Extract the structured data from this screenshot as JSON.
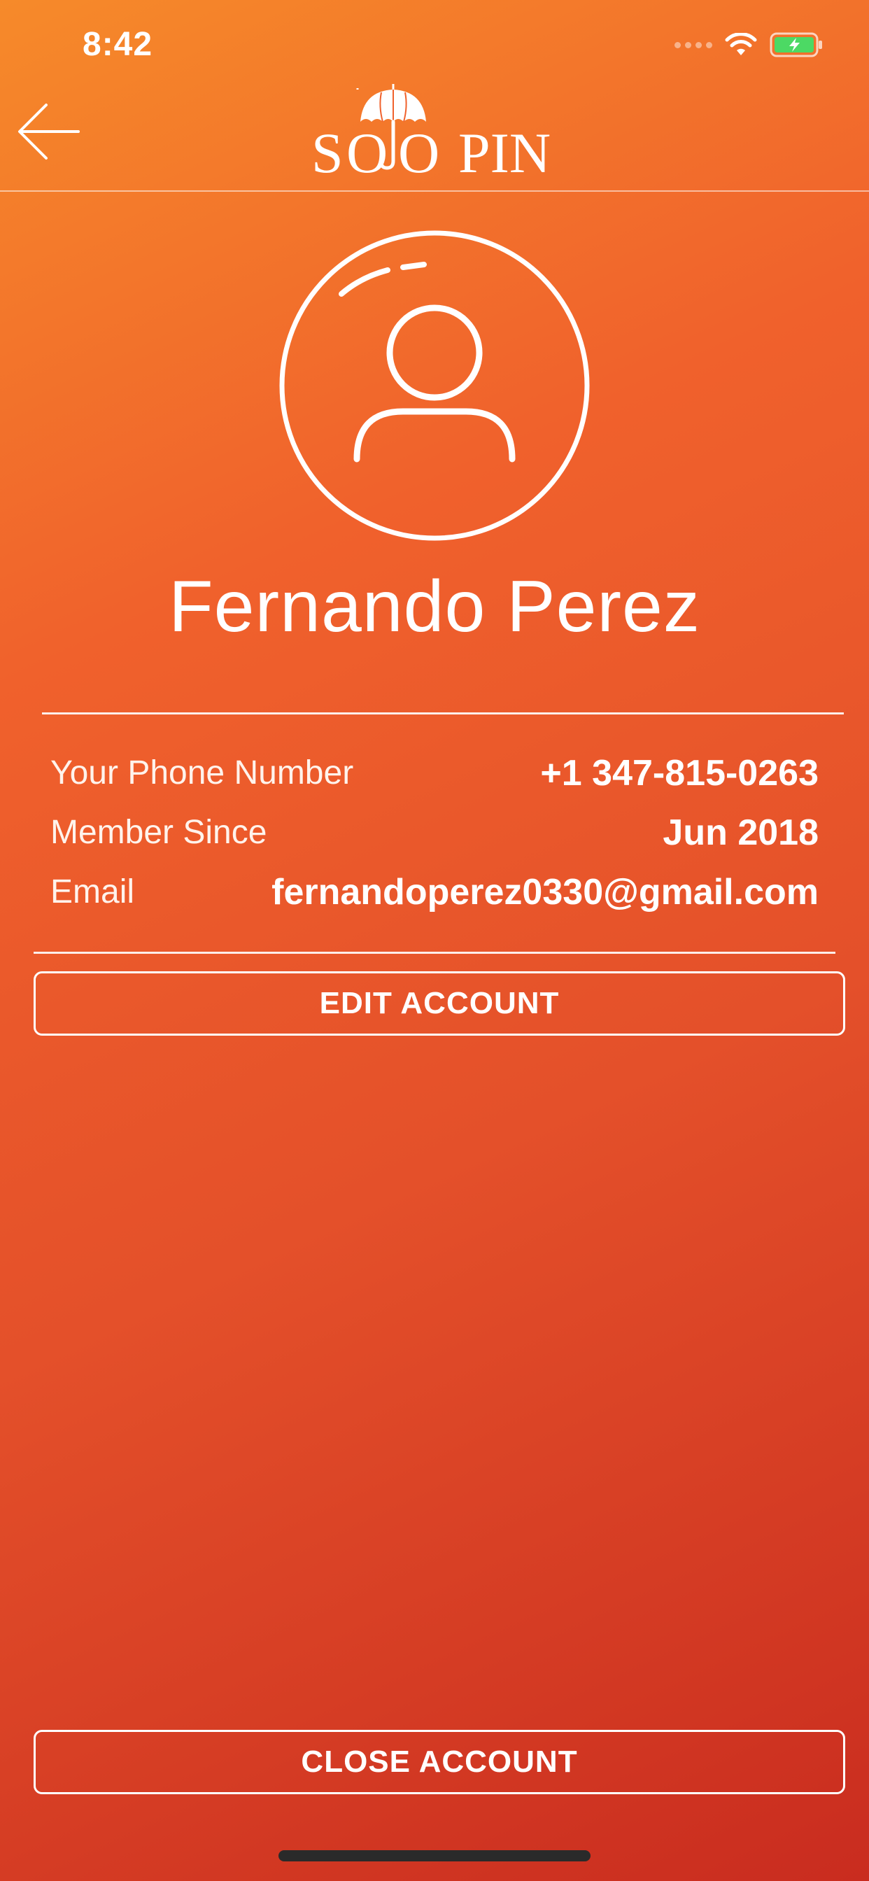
{
  "status_bar": {
    "time": "8:42",
    "icons": [
      "cellular-signal-icon",
      "wifi-icon",
      "battery-charging-icon"
    ]
  },
  "header": {
    "back_icon": "arrow-left-icon",
    "logo_text": "SOLO PIN"
  },
  "profile": {
    "avatar_icon": "user-circle-icon",
    "name": "Fernando Perez",
    "fields": [
      {
        "label": "Your Phone Number",
        "value": "+1 347-815-0263"
      },
      {
        "label": "Member Since",
        "value": "Jun 2018"
      },
      {
        "label": "Email",
        "value": "fernandoperez0330@gmail.com"
      }
    ]
  },
  "actions": {
    "edit_label": "EDIT ACCOUNT",
    "close_label": "CLOSE ACCOUNT"
  },
  "colors": {
    "gradient_start": "#f68a2a",
    "gradient_end": "#c92c1f",
    "battery_fill": "#4cd964"
  }
}
